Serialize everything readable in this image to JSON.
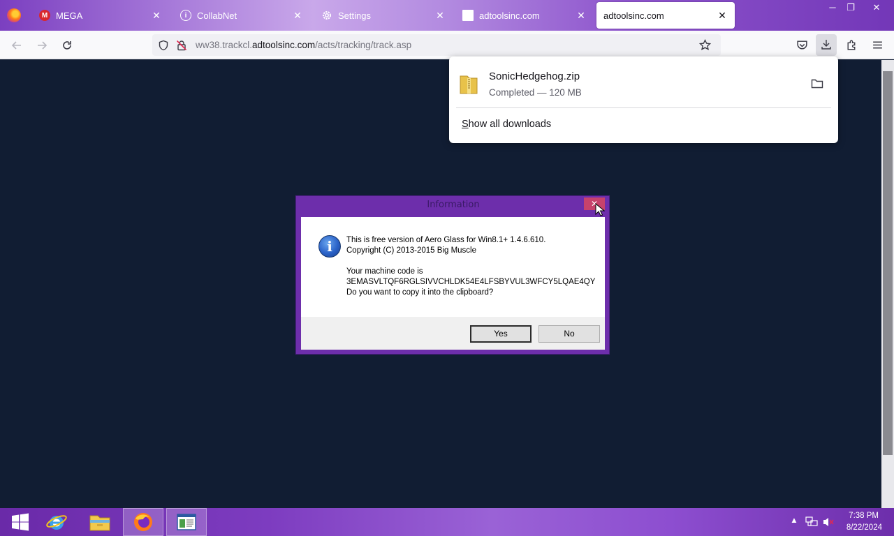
{
  "browser": {
    "tabs": [
      {
        "title": "MEGA",
        "favicon": "mega-icon",
        "active": false
      },
      {
        "title": "CollabNet",
        "favicon": "info-circle-icon",
        "active": false
      },
      {
        "title": "Settings",
        "favicon": "gear-icon",
        "active": false
      },
      {
        "title": "adtoolsinc.com",
        "favicon": "blank-page-icon",
        "active": false
      },
      {
        "title": "adtoolsinc.com",
        "favicon": "none",
        "active": true
      }
    ],
    "tab_close_glyph": "✕",
    "url": {
      "prefix": "ww38.trackcl.",
      "host": "adtoolsinc.com",
      "path": "/acts/tracking/track.asp"
    }
  },
  "downloads_panel": {
    "items": [
      {
        "filename": "SonicHedgehog.zip",
        "status": "Completed — 120 MB",
        "icon": "zip-folder-icon"
      }
    ],
    "show_all_accesskey": "S",
    "show_all_rest": "how all downloads"
  },
  "dialog": {
    "title": "Information",
    "close_glyph": "✕",
    "icon": "i",
    "lines": [
      "This is free version of Aero Glass for Win8.1+ 1.4.6.610.",
      "Copyright (C) 2013-2015 Big Muscle",
      "",
      "Your machine code is",
      "3EMASVLTQF6RGLSIVVCHLDK54E4LFSBYVUL3WFCY5LQAE4QY",
      "Do you want to copy it into the clipboard?"
    ],
    "yes_label": "Yes",
    "no_label": "No"
  },
  "taskbar": {
    "items": [
      "windows-start-icon",
      "internet-explorer-icon",
      "file-explorer-icon",
      "firefox-icon",
      "app-window-icon"
    ],
    "clock_time": "7:38 PM",
    "clock_date": "8/22/2024"
  },
  "colors": {
    "page_background": "#111d33",
    "accent_purple": "#6d2eab",
    "dialog_close": "#c7426c"
  }
}
